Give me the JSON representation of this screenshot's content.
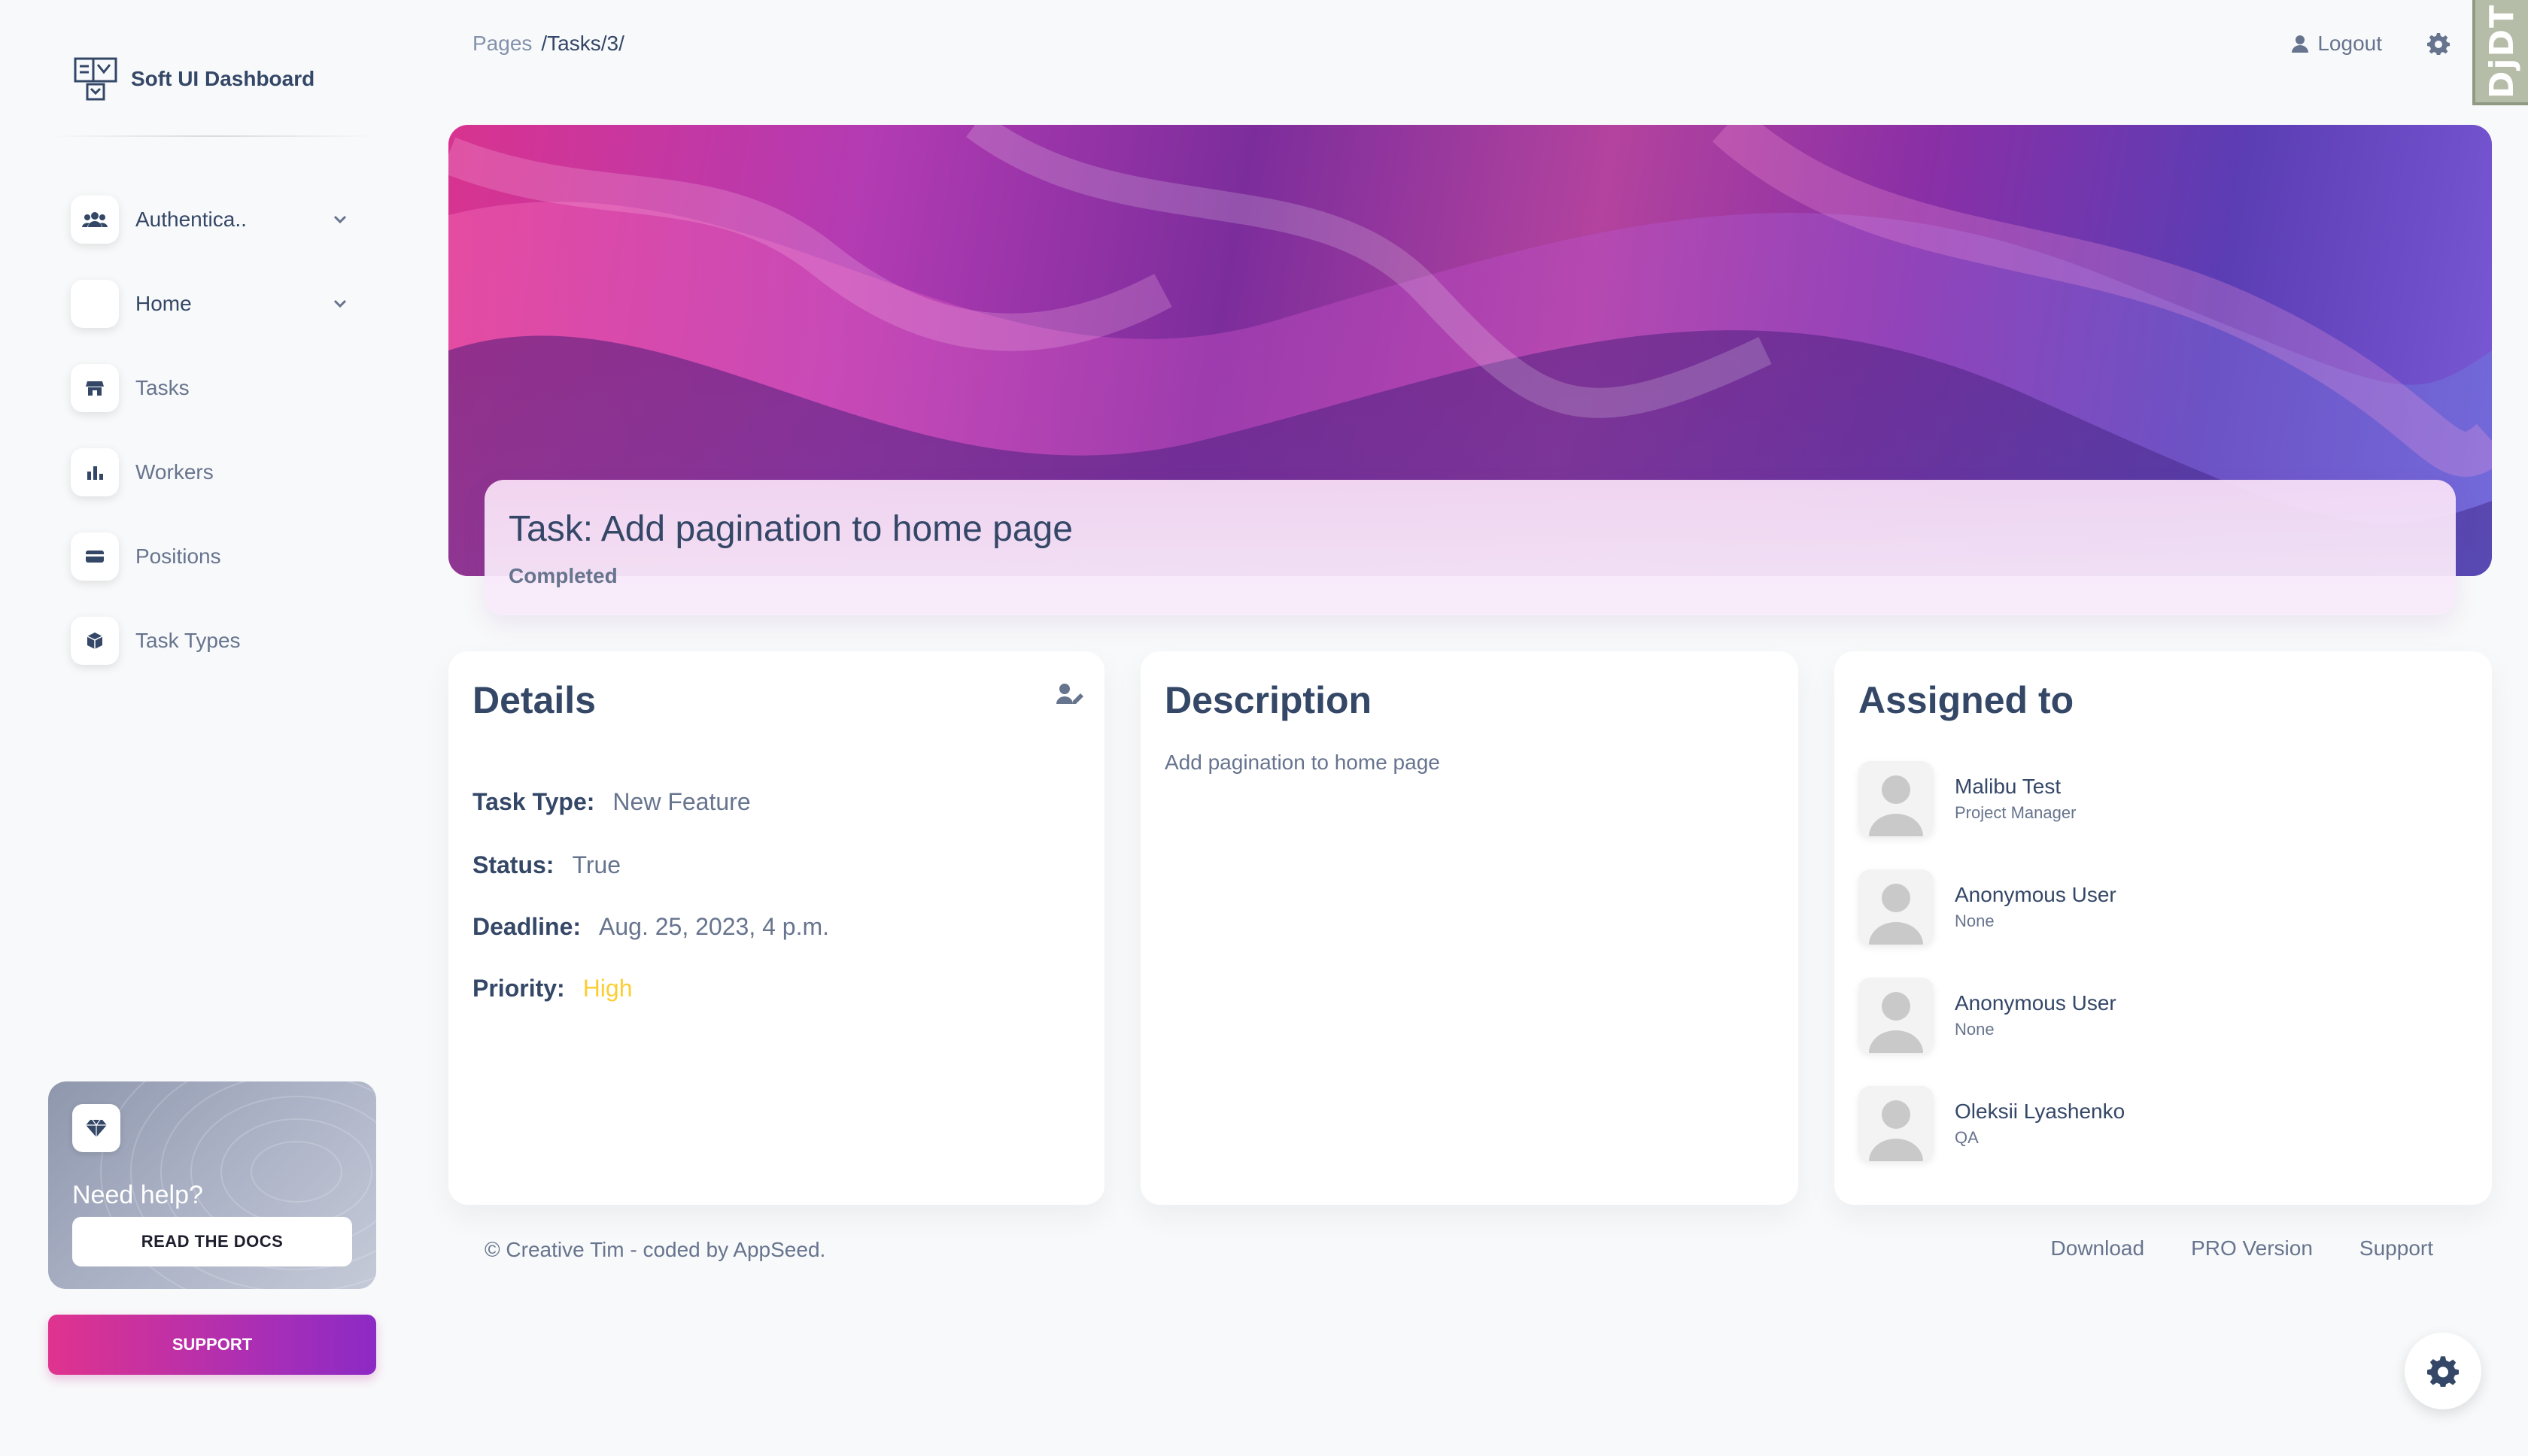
{
  "brand": {
    "name": "Soft UI Dashboard"
  },
  "sidebar": {
    "items": [
      {
        "label": "Authentica..",
        "icon": "users-icon",
        "has_chevron": true
      },
      {
        "label": "Home",
        "icon": "home-icon",
        "has_chevron": true
      },
      {
        "label": "Tasks",
        "icon": "shop-icon",
        "has_chevron": false
      },
      {
        "label": "Workers",
        "icon": "chart-icon",
        "has_chevron": false
      },
      {
        "label": "Positions",
        "icon": "credit-card-icon",
        "has_chevron": false
      },
      {
        "label": "Task Types",
        "icon": "box-icon",
        "has_chevron": false
      }
    ],
    "help": {
      "title": "Need help?",
      "button": "READ THE DOCS",
      "icon": "diamond-icon"
    },
    "support_button": "SUPPORT"
  },
  "breadcrumb": {
    "root": "Pages",
    "current": "/Tasks/3/"
  },
  "topnav": {
    "logout": "Logout",
    "debug_toolbar": "DjDT"
  },
  "task": {
    "title": "Task: Add pagination to home page",
    "status": "Completed"
  },
  "details": {
    "title": "Details",
    "rows": [
      {
        "key": "Task Type:",
        "value": "New Feature"
      },
      {
        "key": "Status:",
        "value": "True"
      },
      {
        "key": "Deadline:",
        "value": "Aug. 25, 2023, 4 p.m."
      },
      {
        "key": "Priority:",
        "value": "High"
      }
    ],
    "priority_color": "#fbcf33"
  },
  "description": {
    "title": "Description",
    "text": "Add pagination to home page"
  },
  "assigned": {
    "title": "Assigned to",
    "people": [
      {
        "name": "Malibu Test",
        "role": "Project Manager"
      },
      {
        "name": "Anonymous User",
        "role": "None"
      },
      {
        "name": "Anonymous User",
        "role": "None"
      },
      {
        "name": "Oleksii Lyashenko",
        "role": "QA"
      }
    ]
  },
  "footer": {
    "copyright": "© Creative Tim - coded by AppSeed.",
    "links": [
      "Download",
      "PRO Version",
      "Support"
    ]
  },
  "colors": {
    "accent_start": "#e0338e",
    "accent_end": "#8c2ac4",
    "text_dark": "#344767",
    "text_muted": "#67748e"
  }
}
